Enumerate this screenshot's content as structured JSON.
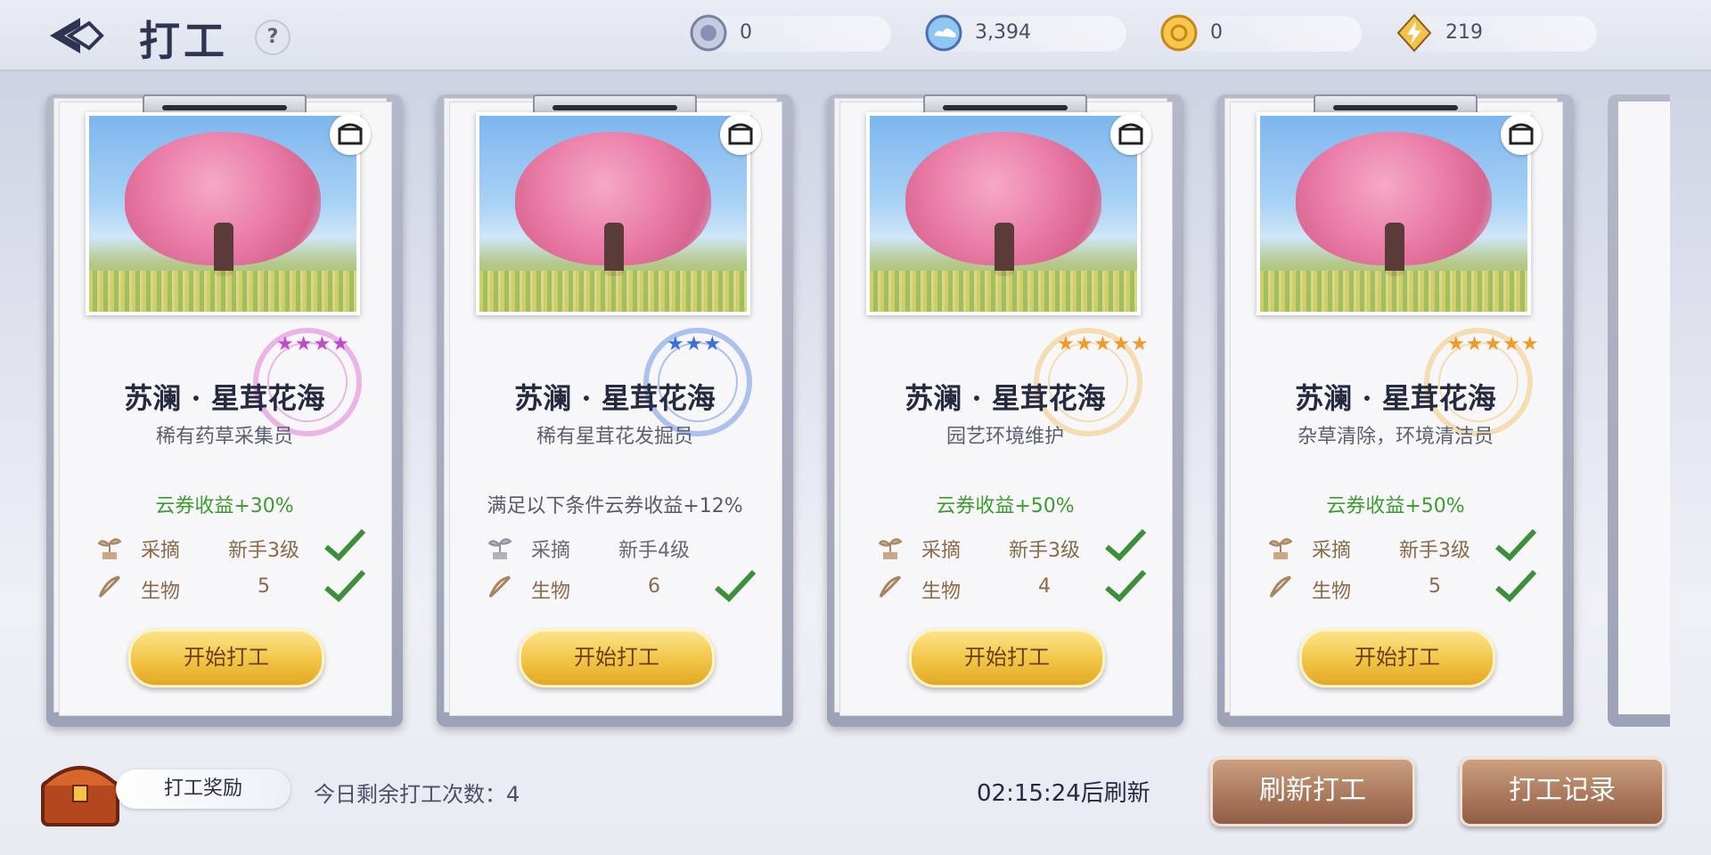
{
  "header": {
    "title": "打工",
    "help_label": "?",
    "currencies": [
      {
        "icon": "silver-coin-icon",
        "value": "0"
      },
      {
        "icon": "cloud-ticket-icon",
        "value": "3,394"
      },
      {
        "icon": "gold-coin-icon",
        "value": "0"
      },
      {
        "icon": "energy-icon",
        "value": "219"
      }
    ]
  },
  "jobs": [
    {
      "location": "苏澜 · 星茸花海",
      "job_title": "稀有药草采集员",
      "bonus": "云券收益+30%",
      "stars": "★★★★",
      "star_color": "#c24ac9",
      "requirements": [
        {
          "name": "采摘",
          "value": "新手3级"
        },
        {
          "name": "生物",
          "value": "5"
        }
      ],
      "button": "开始打工"
    },
    {
      "location": "苏澜 · 星茸花海",
      "job_title": "稀有星茸花发掘员",
      "bonus": "满足以下条件云券收益+12%",
      "stars": "★★★",
      "star_color": "#3c6ee0",
      "requirements": [
        {
          "name": "采摘",
          "value": "新手4级"
        },
        {
          "name": "生物",
          "value": "6"
        }
      ],
      "button": "开始打工"
    },
    {
      "location": "苏澜 · 星茸花海",
      "job_title": "园艺环境维护",
      "bonus": "云券收益+50%",
      "stars": "★★★★★",
      "star_color": "#f09a2a",
      "requirements": [
        {
          "name": "采摘",
          "value": "新手3级"
        },
        {
          "name": "生物",
          "value": "4"
        }
      ],
      "button": "开始打工"
    },
    {
      "location": "苏澜 · 星茸花海",
      "job_title": "杂草清除，环境清洁员",
      "bonus": "云券收益+50%",
      "stars": "★★★★★",
      "star_color": "#f09a2a",
      "requirements": [
        {
          "name": "采摘",
          "value": "新手3级"
        },
        {
          "name": "生物",
          "value": "5"
        }
      ],
      "button": "开始打工"
    }
  ],
  "footer": {
    "reward_label": "打工奖励",
    "remaining": "今日剩余打工次数：4",
    "timer": "02:15:24后刷新",
    "refresh_button": "刷新打工",
    "record_button": "打工记录"
  },
  "colors": {
    "bonus_green": "#3c9c2e",
    "gold_button": "#f2c445",
    "brown_button": "#a9765a",
    "check_green": "#3d8f3a"
  }
}
